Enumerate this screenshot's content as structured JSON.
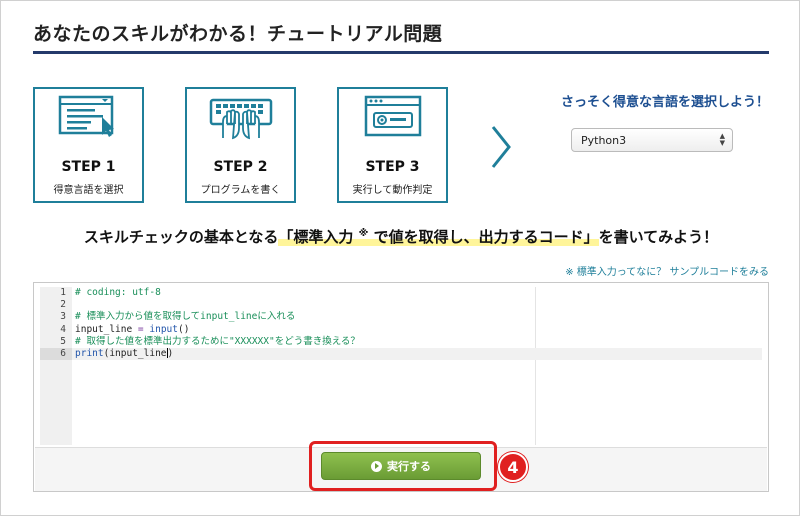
{
  "page": {
    "title": "あなたのスキルがわかる！チュートリアル問題"
  },
  "steps": [
    {
      "title": "STEP 1",
      "subtitle": "得意言語を選択",
      "icon": "language-select-icon"
    },
    {
      "title": "STEP 2",
      "subtitle": "プログラムを書く",
      "icon": "keyboard-typing-icon"
    },
    {
      "title": "STEP 3",
      "subtitle": "実行して動作判定",
      "icon": "browser-window-icon"
    }
  ],
  "language": {
    "heading": "さっそく得意な言語を選択しよう！",
    "selected": "Python3"
  },
  "instruction": {
    "before": "スキルチェックの基本となる",
    "highlight_a": "「標準入力",
    "note_mark": "※",
    "highlight_b": "で値を取得し、出力するコード」",
    "after": "を書いてみよう！"
  },
  "sample_link": "※ 標準入力ってなに？ サンプルコードをみる",
  "editor": {
    "line_numbers": [
      "1",
      "2",
      "3",
      "4",
      "5",
      "6"
    ],
    "line1": "# coding: utf-8",
    "line3": "# 標準入力から値を取得してinput_lineに入れる",
    "line4_var": "input_line",
    "line4_op": " = ",
    "line4_func": "input",
    "line4_end": "()",
    "line5": "# 取得した値を標準出力するために\"XXXXXX\"をどう書き換える？",
    "line6_func": "print",
    "line6_a": "(input_line",
    "line6_b": ")"
  },
  "run_button": {
    "label": "実行する",
    "icon": "play-circle-icon"
  },
  "annotation": {
    "badge": "4"
  },
  "colors": {
    "accent": "#1f7f9a",
    "title_rule": "#243a6b",
    "heading_blue": "#1d4f91",
    "run_green": "#7aae41",
    "annotation_red": "#e02020",
    "highlight_yellow": "#fff59a"
  }
}
